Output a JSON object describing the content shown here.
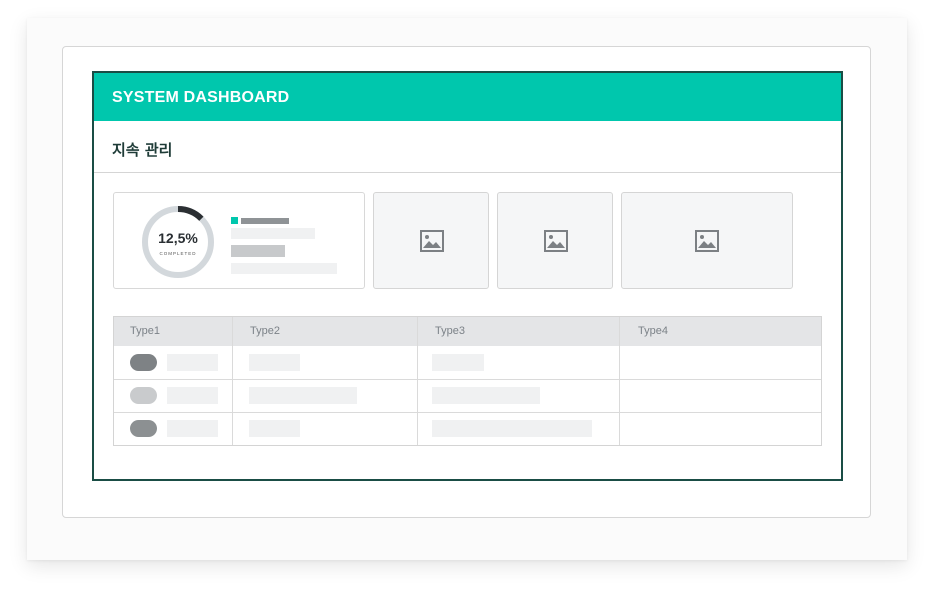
{
  "dashboard": {
    "title": "SYSTEM DASHBOARD",
    "page_title": "지속 관리"
  },
  "stat": {
    "value": "12,5%",
    "caption": "COMPLETED",
    "progress_fraction": 0.125,
    "colors": {
      "progress": "#2b2f33",
      "track": "#d3d8dc",
      "legend": "#00c7ad"
    }
  },
  "image_placeholders": [
    "image-icon",
    "image-icon",
    "image-icon"
  ],
  "table": {
    "headers": [
      "Type1",
      "Type2",
      "Type3",
      "Type4"
    ],
    "status_pill_colors": [
      "#7e8285",
      "#c9cbcd",
      "#8c9092"
    ]
  },
  "colors": {
    "accent": "#00c7ad",
    "frame_border": "#1a4d45",
    "title_text": "#1e3b37"
  }
}
